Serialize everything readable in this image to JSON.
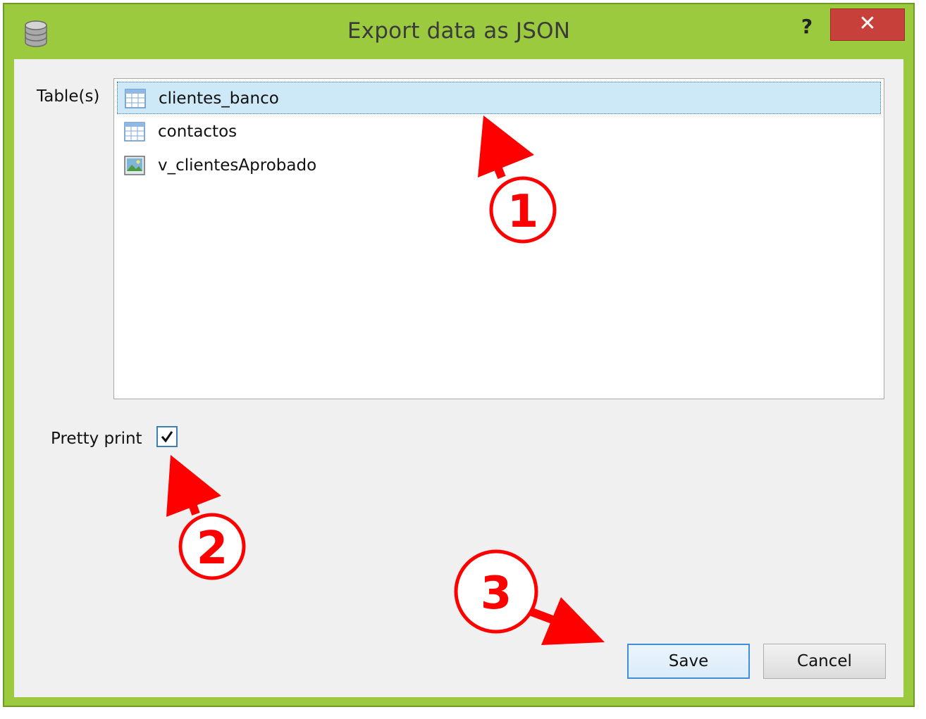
{
  "window": {
    "title": "Export data as JSON",
    "help_label": "?",
    "close_label": "✕"
  },
  "tables": {
    "label": "Table(s)",
    "items": [
      {
        "name": "clientes_banco",
        "icon": "table-icon",
        "selected": true
      },
      {
        "name": "contactos",
        "icon": "table-icon",
        "selected": false
      },
      {
        "name": "v_clientesAprobado",
        "icon": "view-icon",
        "selected": false
      }
    ]
  },
  "options": {
    "pretty_print_label": "Pretty print",
    "pretty_print_checked": true
  },
  "buttons": {
    "save_label": "Save",
    "cancel_label": "Cancel"
  },
  "annotations": {
    "step1": "1",
    "step2": "2",
    "step3": "3",
    "color": "#ff0000"
  }
}
